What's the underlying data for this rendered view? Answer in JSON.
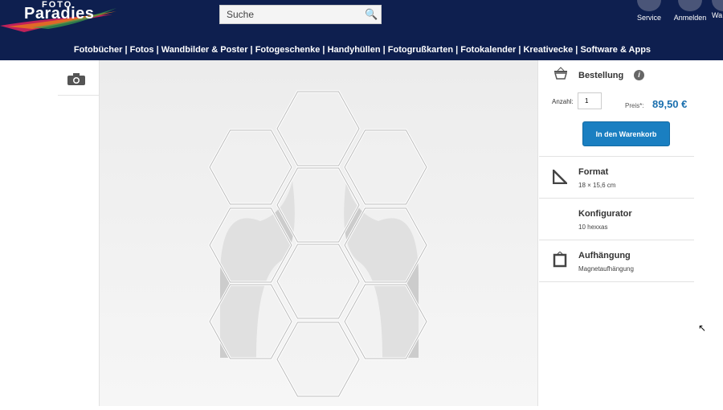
{
  "header": {
    "logo_top": "FOTO",
    "logo_main": "Paradies",
    "search_placeholder": "Suche",
    "service": "Service",
    "login": "Anmelden",
    "cart_partial": "Wa"
  },
  "nav": "Fotobücher | Fotos | Wandbilder & Poster | Fotogeschenke | Handyhüllen | Fotogrußkarten | Fotokalender | Kreativecke | Software & Apps",
  "order": {
    "title": "Bestellung",
    "qty_label": "Anzahl:",
    "qty": "1",
    "price_label": "Preis*:",
    "price": "89,50 €",
    "add_to_cart": "In den Warenkorb"
  },
  "options": [
    {
      "title": "Format",
      "value": "18 × 15,6 cm"
    },
    {
      "title": "Konfigurator",
      "value": "10 hexxas"
    },
    {
      "title": "Aufhängung",
      "value": "Magnetaufhängung"
    }
  ],
  "colors": {
    "header": "#0e1f4f",
    "accent": "#1a7fc1",
    "price": "#1a6fae"
  }
}
